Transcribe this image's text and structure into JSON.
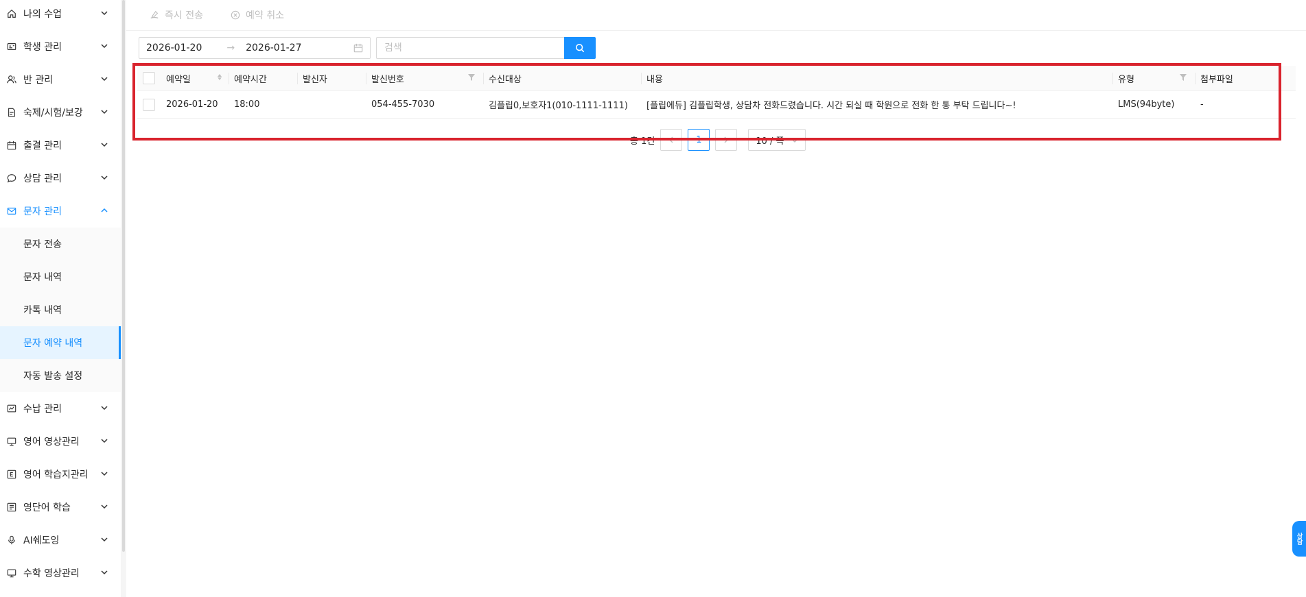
{
  "sidebar": {
    "items": [
      {
        "label": "나의 수업",
        "icon": "home-icon"
      },
      {
        "label": "학생 관리",
        "icon": "id-card-icon"
      },
      {
        "label": "반 관리",
        "icon": "users-icon"
      },
      {
        "label": "숙제/시험/보강",
        "icon": "document-icon"
      },
      {
        "label": "출결 관리",
        "icon": "calendar-icon"
      },
      {
        "label": "상담 관리",
        "icon": "chat-icon"
      },
      {
        "label": "문자 관리",
        "icon": "mail-icon"
      },
      {
        "label": "수납 관리",
        "icon": "receipt-icon"
      },
      {
        "label": "영어 영상관리",
        "icon": "monitor-icon"
      },
      {
        "label": "영어 학습지관리",
        "icon": "letter-e-icon"
      },
      {
        "label": "영단어 학습",
        "icon": "book-icon"
      },
      {
        "label": "AI쉐도잉",
        "icon": "microphone-icon"
      },
      {
        "label": "수학 영상관리",
        "icon": "monitor-icon"
      }
    ],
    "sub_items": [
      "문자 전송",
      "문자 내역",
      "카톡 내역",
      "문자 예약 내역",
      "자동 발송 설정"
    ]
  },
  "toolbar": {
    "send_now": "즉시 전송",
    "cancel_reservation": "예약 취소"
  },
  "filters": {
    "start_date": "2026-01-20",
    "end_date": "2026-01-27",
    "search_placeholder": "검색"
  },
  "table": {
    "headers": [
      "예약일",
      "예약시간",
      "발신자",
      "발신번호",
      "수신대상",
      "내용",
      "유형",
      "첨부파일"
    ],
    "rows": [
      {
        "date": "2026-01-20",
        "time": "18:00",
        "sender": "",
        "sender_number": "054-455-7030",
        "recipient": "김플립0,보호자1(010-1111-1111)",
        "content": "[플립에듀] 김플립학생, 상담차 전화드렸습니다. 시간 되실 때 학원으로 전화 한 통 부탁 드립니다~!",
        "type": "LMS(94byte)",
        "attachment": "-"
      }
    ]
  },
  "pagination": {
    "total": "총 1건",
    "current_page": "1",
    "page_size": "10 / 쪽"
  },
  "floating_button": "상담",
  "colors": {
    "accent": "#1890ff",
    "highlight": "#d9232d"
  }
}
